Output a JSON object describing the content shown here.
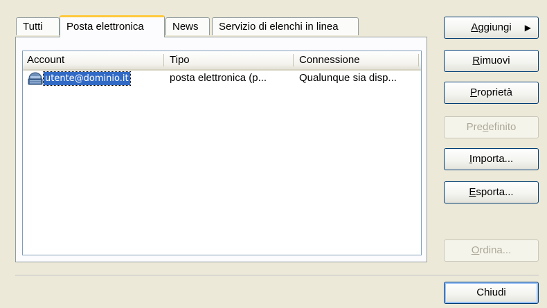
{
  "tabs": [
    {
      "label": "Tutti",
      "active": false
    },
    {
      "label": "Posta elettronica",
      "active": true
    },
    {
      "label": "News",
      "active": false
    },
    {
      "label": "Servizio di elenchi in linea",
      "active": false
    }
  ],
  "list": {
    "columns": [
      "Account",
      "Tipo",
      "Connessione"
    ],
    "rows": [
      {
        "icon": "mail-account-icon",
        "account": "utente@dominio.it",
        "tipo": "posta elettronica (p...",
        "connessione": "Qualunque sia disp..."
      }
    ]
  },
  "buttons": {
    "aggiungi": {
      "label": "Aggiungi",
      "mnemonic_index": 0,
      "enabled": true,
      "has_submenu": true
    },
    "rimuovi": {
      "label": "Rimuovi",
      "mnemonic_index": 0,
      "enabled": true
    },
    "proprieta": {
      "label": "Proprietà",
      "mnemonic_index": 0,
      "enabled": true
    },
    "predefinito": {
      "label": "Predefinito",
      "mnemonic_index": 3,
      "enabled": false
    },
    "importa": {
      "label": "Importa...",
      "mnemonic_index": 0,
      "enabled": true
    },
    "esporta": {
      "label": "Esporta...",
      "mnemonic_index": 0,
      "enabled": true
    },
    "ordina": {
      "label": "Ordina...",
      "mnemonic_index": 0,
      "enabled": false
    },
    "chiudi": {
      "label": "Chiudi",
      "enabled": true
    }
  },
  "colors": {
    "dialog_bg": "#ece9d8",
    "selection_bg": "#316ac5",
    "active_tab_accent": "#ffc83c",
    "button_border": "#003c74"
  }
}
